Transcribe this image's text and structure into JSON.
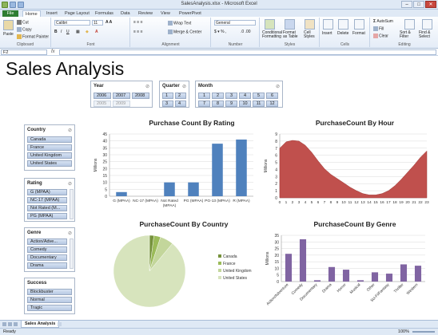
{
  "window": {
    "title": "SalesAnalysis.xlsx - Microsoft Excel"
  },
  "ribbon_tabs": [
    "File",
    "Home",
    "Insert",
    "Page Layout",
    "Formulas",
    "Data",
    "Review",
    "View",
    "PowerPivot"
  ],
  "ribbon": {
    "clipboard": {
      "paste": "Paste",
      "cut": "Cut",
      "copy": "Copy",
      "format_painter": "Format Painter",
      "label": "Clipboard"
    },
    "font": {
      "name": "Calibri",
      "size": "11",
      "label": "Font"
    },
    "alignment": {
      "wrap": "Wrap Text",
      "merge": "Merge & Center",
      "label": "Alignment"
    },
    "number": {
      "format": "General",
      "label": "Number"
    },
    "styles": {
      "conditional": "Conditional Formatting",
      "format_table": "Format as Table",
      "cell_styles": "Cell Styles",
      "label": "Styles"
    },
    "cells": {
      "insert": "Insert",
      "delete": "Delete",
      "format": "Format",
      "label": "Cells"
    },
    "editing": {
      "autosum": "AutoSum",
      "fill": "Fill",
      "clear": "Clear",
      "sort": "Sort & Filter",
      "find": "Find & Select",
      "label": "Editing"
    }
  },
  "formula_bar": {
    "name_box": "F2",
    "fx": "fx",
    "value": ""
  },
  "sheet": {
    "title": "Sales Analysis"
  },
  "slicers": {
    "year": {
      "header": "Year",
      "items": [
        "2006",
        "2007",
        "2008",
        "2005",
        "2009"
      ]
    },
    "quarter": {
      "header": "Quarter",
      "items": [
        "1",
        "2",
        "3",
        "4"
      ]
    },
    "month": {
      "header": "Month",
      "items": [
        "1",
        "2",
        "3",
        "4",
        "5",
        "6",
        "7",
        "8",
        "9",
        "10",
        "11",
        "12"
      ]
    },
    "country": {
      "header": "Country",
      "items": [
        "Canada",
        "France",
        "United Kingdom",
        "United States"
      ]
    },
    "rating": {
      "header": "Rating",
      "items": [
        "G (MPAA)",
        "NC-17 (MPAA)",
        "Not Rated (M...",
        "PG (MPAA)"
      ]
    },
    "genre": {
      "header": "Genre",
      "items": [
        "Action/Adve...",
        "Comedy",
        "Documentary",
        "Drama"
      ]
    },
    "success": {
      "header": "Success",
      "items": [
        "Blockbuster",
        "Normal",
        "Tragic"
      ]
    }
  },
  "sheet_tabs": {
    "active": "Sales Analysis"
  },
  "status": {
    "ready": "Ready",
    "zoom": "100%"
  },
  "colors": {
    "bar": "#4f81bd",
    "area": "#c0504d",
    "genre": "#8064a2",
    "pie": [
      "#76923c",
      "#9bbb59",
      "#c3d69b",
      "#d7e4bd"
    ]
  },
  "chart_data": [
    {
      "type": "bar",
      "title": "Purchase Count By Rating",
      "ylabel": "Millions",
      "categories": [
        "G (MPAA)",
        "NC-17 (MPAA)",
        "Not Rated (MPAA)",
        "PG (MPAA)",
        "PG-13 (MPAA)",
        "R (MPAA)"
      ],
      "values": [
        3,
        0,
        10,
        10,
        38,
        41
      ],
      "ylim": [
        0,
        45
      ],
      "yticks": [
        "0",
        "5",
        "10",
        "15",
        "20",
        "25",
        "30",
        "35",
        "40",
        "45"
      ]
    },
    {
      "type": "area",
      "title": "PurchaseCount By Hour",
      "ylabel": "Millions",
      "x": [
        "0",
        "1",
        "2",
        "3",
        "4",
        "5",
        "6",
        "7",
        "8",
        "9",
        "10",
        "11",
        "12",
        "13",
        "14",
        "15",
        "16",
        "17",
        "18",
        "19",
        "20",
        "21",
        "22",
        "23"
      ],
      "values": [
        7.0,
        7.9,
        8.1,
        8.0,
        7.4,
        6.4,
        5.2,
        4.1,
        3.3,
        2.7,
        2.1,
        1.5,
        1.0,
        0.6,
        0.4,
        0.4,
        0.6,
        1.0,
        1.7,
        2.6,
        3.6,
        4.6,
        5.7,
        6.6
      ],
      "ylim": [
        0,
        9
      ],
      "yticks": [
        "0",
        "1",
        "2",
        "3",
        "4",
        "5",
        "6",
        "7",
        "8",
        "9"
      ]
    },
    {
      "type": "pie",
      "title": "PurchaseCount By Country",
      "labels": [
        "Canada",
        "France",
        "United Kingdom",
        "United States"
      ],
      "values": [
        2,
        3,
        6,
        89
      ]
    },
    {
      "type": "bar",
      "title": "PurchaseCount By Genre",
      "ylabel": "Millions",
      "categories": [
        "Action/Adventure",
        "Comedy",
        "Documentary",
        "Drama",
        "Horror",
        "Musical",
        "Other",
        "Sci-Fi/Fantasy",
        "Thriller",
        "Western"
      ],
      "values": [
        21,
        32,
        1,
        11,
        9,
        1,
        7,
        6,
        13,
        12
      ],
      "ylim": [
        0,
        35
      ],
      "yticks": [
        "0",
        "5",
        "10",
        "15",
        "20",
        "25",
        "30",
        "35"
      ]
    }
  ]
}
